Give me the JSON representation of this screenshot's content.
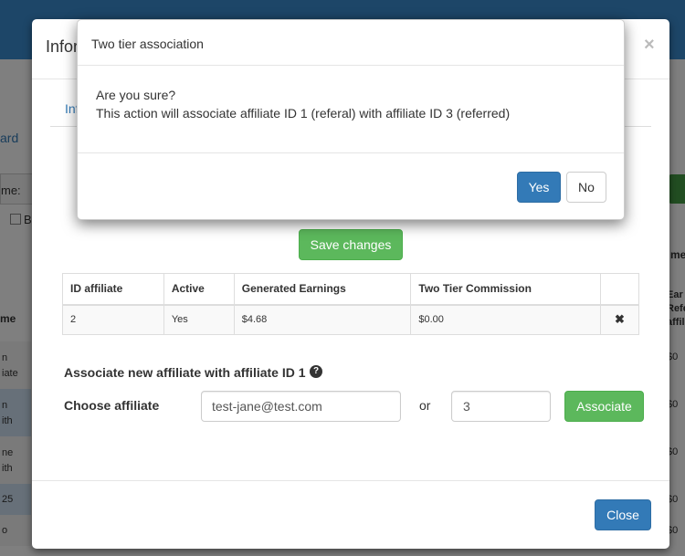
{
  "background": {
    "fragments": {
      "title_fragment": "Infor",
      "tab_fragment": "Inf",
      "link_fragment": "ard",
      "name_label_fragment": "me:",
      "checkbox_fragment": "B",
      "col_header_fragment": "me",
      "right_header_fragment": "me",
      "right_sub_header": [
        "Ear",
        "Refe",
        "affili"
      ]
    },
    "left_rows": [
      [
        "n",
        "iate"
      ],
      [
        "n",
        "ith"
      ],
      [
        "ne",
        "ith"
      ],
      [
        "25"
      ],
      [
        "o"
      ]
    ],
    "right_values": [
      "$0",
      "$0",
      "$0",
      "$0",
      "$0"
    ]
  },
  "main_modal": {
    "close_symbol": "×",
    "save_button": "Save changes",
    "table": {
      "headers": [
        "ID affiliate",
        "Active",
        "Generated Earnings",
        "Two Tier Commission",
        ""
      ],
      "rows": [
        {
          "id": "2",
          "active": "Yes",
          "earnings": "$4.68",
          "commission": "$0.00",
          "action": "✖"
        }
      ]
    },
    "associate": {
      "title": "Associate new affiliate with affiliate ID 1",
      "help_icon": "?",
      "choose_label": "Choose affiliate",
      "email_value": "test-jane@test.com",
      "or_label": "or",
      "id_value": "3",
      "button": "Associate"
    },
    "close_button": "Close"
  },
  "confirm_modal": {
    "title": "Two tier association",
    "line1": "Are you sure?",
    "line2": "This action will associate affiliate ID 1 (referal) with affiliate ID 3 (referred)",
    "yes_button": "Yes",
    "no_button": "No"
  }
}
